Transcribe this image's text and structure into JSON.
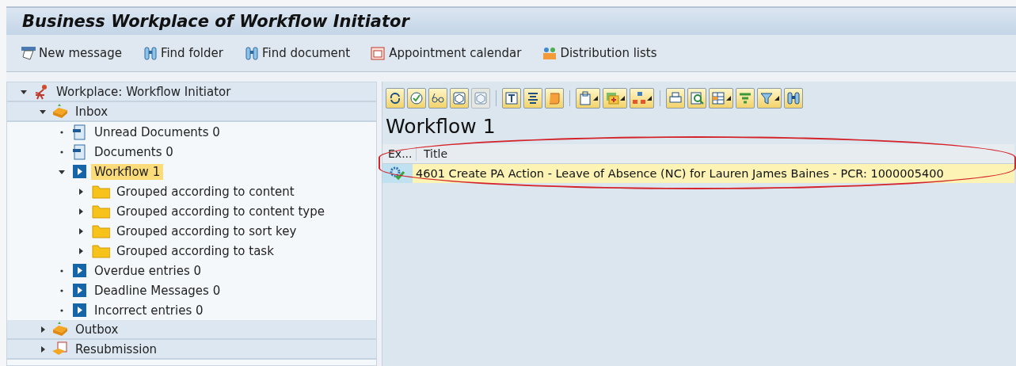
{
  "window": {
    "title": "Business Workplace of Workflow Initiator"
  },
  "toolbar": [
    {
      "label": "New message",
      "kind": "message"
    },
    {
      "label": "Find folder",
      "kind": "binoculars"
    },
    {
      "label": "Find document",
      "kind": "binoculars"
    },
    {
      "label": "Appointment calendar",
      "kind": "calendar"
    },
    {
      "label": "Distribution lists",
      "kind": "people"
    }
  ],
  "tree": [
    {
      "label": "Workplace: Workflow Initiator",
      "kind": "person",
      "expanded": true,
      "selected": false,
      "children": [
        {
          "label": "Inbox",
          "kind": "tray",
          "expanded": true,
          "selected": false,
          "children": [
            {
              "label": "Unread Documents 0",
              "kind": "document",
              "selected": false
            },
            {
              "label": "Documents 0",
              "kind": "document",
              "selected": false
            },
            {
              "label": "Workflow 1",
              "kind": "workflow",
              "expanded": true,
              "selected": true,
              "children": [
                {
                  "label": "Grouped according to content",
                  "kind": "folder",
                  "expanded": false,
                  "selected": false
                },
                {
                  "label": "Grouped according to content type",
                  "kind": "folder",
                  "expanded": false,
                  "selected": false
                },
                {
                  "label": "Grouped according to sort key",
                  "kind": "folder",
                  "expanded": false,
                  "selected": false
                },
                {
                  "label": "Grouped according to task",
                  "kind": "folder",
                  "expanded": false,
                  "selected": false
                }
              ]
            },
            {
              "label": "Overdue entries 0",
              "kind": "workflow",
              "selected": false
            },
            {
              "label": "Deadline Messages 0",
              "kind": "workflow",
              "selected": false
            },
            {
              "label": "Incorrect entries 0",
              "kind": "workflow",
              "selected": false
            }
          ]
        },
        {
          "label": "Outbox",
          "kind": "tray",
          "expanded": false,
          "selected": false
        },
        {
          "label": "Resubmission",
          "kind": "resubmission",
          "expanded": false,
          "selected": false
        }
      ]
    }
  ],
  "list_toolbar": [
    {
      "kind": "refresh",
      "disabled": false,
      "menu": false
    },
    {
      "kind": "execute",
      "disabled": false,
      "menu": false
    },
    {
      "kind": "glasses",
      "disabled": false,
      "menu": false
    },
    {
      "kind": "cube",
      "disabled": false,
      "menu": false
    },
    {
      "kind": "cube",
      "disabled": true,
      "menu": false
    },
    {
      "kind": "separator"
    },
    {
      "kind": "text",
      "disabled": false,
      "menu": false
    },
    {
      "kind": "lines",
      "disabled": false,
      "menu": false
    },
    {
      "kind": "scroll",
      "disabled": false,
      "menu": false
    },
    {
      "kind": "separator"
    },
    {
      "kind": "clipboard",
      "disabled": false,
      "menu": true
    },
    {
      "kind": "add",
      "disabled": false,
      "menu": true
    },
    {
      "kind": "hierarchy",
      "disabled": false,
      "menu": true
    },
    {
      "kind": "separator"
    },
    {
      "kind": "print",
      "disabled": false,
      "menu": false
    },
    {
      "kind": "find",
      "disabled": false,
      "menu": false
    },
    {
      "kind": "grid",
      "disabled": false,
      "menu": true
    },
    {
      "kind": "filter",
      "disabled": false,
      "menu": false
    },
    {
      "kind": "funnel",
      "disabled": false,
      "menu": true
    },
    {
      "kind": "binoculars",
      "disabled": false,
      "menu": false
    }
  ],
  "list": {
    "title": "Workflow 1",
    "columns": [
      "Ex...",
      "Title"
    ],
    "rows": [
      {
        "kind": "executed",
        "title": "4601 Create PA Action - Leave of Absence (NC) for Lauren James Baines - PCR: 1000005400",
        "selected": true
      }
    ],
    "highlighted": true
  }
}
